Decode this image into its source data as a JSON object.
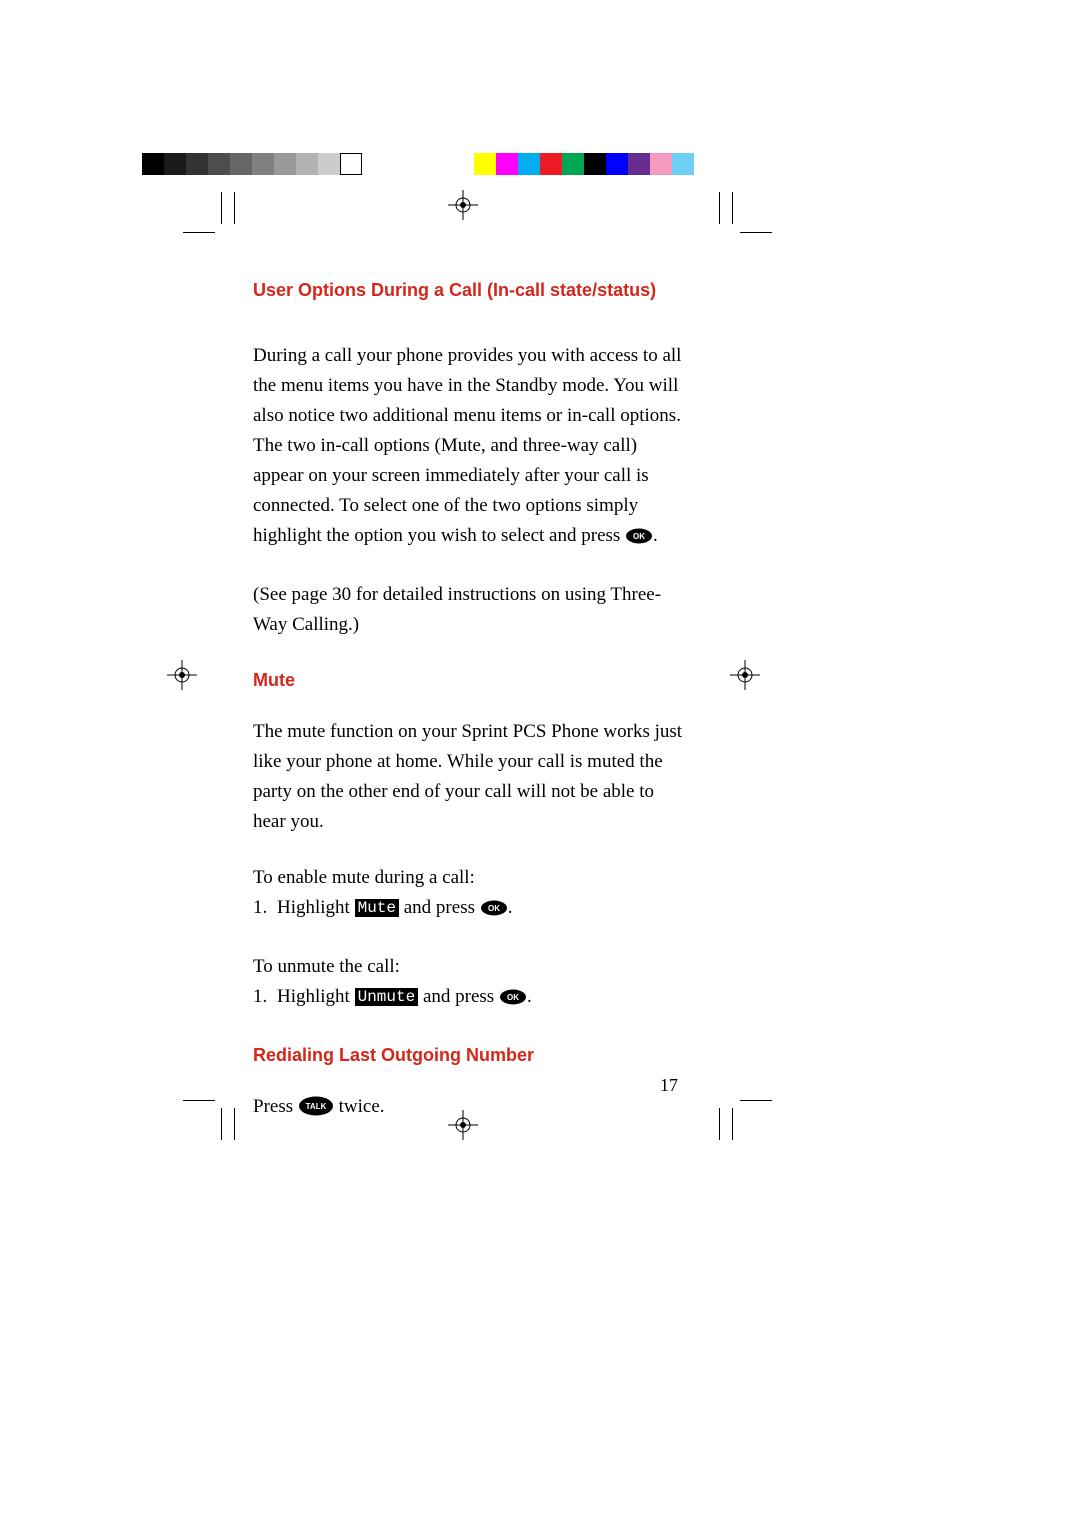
{
  "headings": {
    "user_options": "User Options During a Call (In-call state/status)",
    "mute": "Mute",
    "redial": "Redialing Last Outgoing Number"
  },
  "paragraphs": {
    "intro_a": "During a call your phone provides you with access to all the menu items you have in the Standby mode. You will also notice two additional menu items or in-call options. The two in-call options (Mute, and three-way call) appear on your screen immediately after your call is connected. To select one of the two options simply highlight the option you wish to select and press ",
    "intro_b": ".",
    "see_page": "(See page 30 for detailed instructions on using Three-Way Calling.)",
    "mute_desc": "The mute function on your Sprint PCS Phone works just like your phone at home. While your call is muted the party on the other end of your call will not be able to hear you.",
    "enable_mute": "To enable mute during a call:",
    "unmute": "To unmute the call:",
    "redial_a": "Press ",
    "redial_b": " twice."
  },
  "steps": {
    "highlight_a": "Highlight ",
    "highlight_b": " and press ",
    "highlight_c": "."
  },
  "labels": {
    "mute": "Mute",
    "unmute": "Unmute",
    "ok": "OK",
    "talk": "TALK"
  },
  "page_number": "17",
  "color_bars": {
    "gray": [
      "#000000",
      "#1a1a1a",
      "#333333",
      "#4d4d4d",
      "#666666",
      "#808080",
      "#999999",
      "#b3b3b3",
      "#cccccc",
      "#ffffff"
    ],
    "color": [
      "#ffff00",
      "#ff00ff",
      "#00aeef",
      "#ed1c24",
      "#00a651",
      "#000000",
      "#0000ff",
      "#662d91",
      "#f49ac1",
      "#6dcff6"
    ]
  }
}
